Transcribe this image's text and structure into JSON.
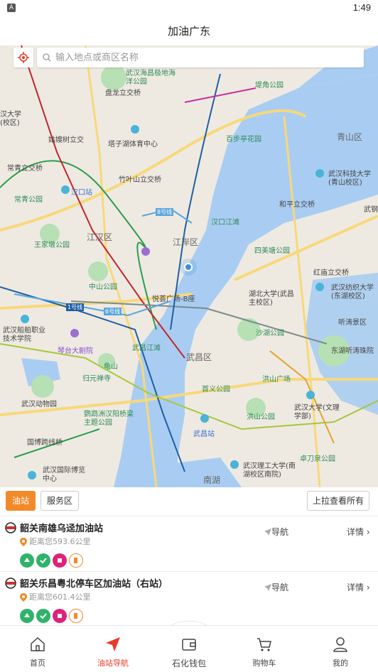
{
  "status": {
    "time": "1:49",
    "app_glyph": "A"
  },
  "title": "加油广东",
  "search": {
    "placeholder": "输入地点或商区名称"
  },
  "map": {
    "labels": [
      "武汉海昌极地海洋公园",
      "盘龙立交桥",
      "堤角公园",
      "姑嫂树立交",
      "塔子湖体育中心",
      "百步亭花园",
      "常青立交桥",
      "竹叶山立交桥",
      "汉口站",
      "常青公园",
      "8号线",
      "汉口江滩",
      "武汉科技大学(青山校区)",
      "和平立交桥",
      "武钢",
      "王家墩公园",
      "江汉区",
      "江岸区",
      "四美塘公园",
      "中山公园",
      "悦荟广场-B座",
      "湖北大学(武昌主校区)",
      "红庙立交桥",
      "武汉纺织大学(东湖校区)",
      "1号线",
      "6号线",
      "沙湖公园",
      "听涛景区",
      "武汉船舶职业技术学院",
      "琴台大剧院",
      "武昌江滩",
      "武昌区",
      "东湖听涛珠院",
      "龟山",
      "归元禅寺",
      "洪山广场",
      "首义公园",
      "武汉动物园",
      "鹦鹉洲汉阳桥梁主题公园",
      "洪山公园",
      "武汉大学(文理学部)",
      "国博跨线桥",
      "武昌站",
      "卓刀泉公园",
      "武汉国际博览中心",
      "南湖",
      "武汉理工大学(南湖校区南院)",
      "青山区",
      "汉大学(校区)"
    ]
  },
  "filters": {
    "gas": "油站",
    "service": "服务区",
    "pull_all": "上拉查看所有"
  },
  "stations": [
    {
      "name": "韶关南雄乌迳加油站",
      "distance": "距离您593.6公里",
      "nav": "导航",
      "detail": "详情"
    },
    {
      "name": "韶关乐昌粤北停车区加油站（右站）",
      "distance": "距离您601.4公里",
      "nav": "导航",
      "detail": "详情"
    }
  ],
  "tabs": [
    {
      "label": "首页",
      "icon": "home-icon"
    },
    {
      "label": "油站导航",
      "icon": "navigation-arrow-icon"
    },
    {
      "label": "石化钱包",
      "icon": "wallet-icon"
    },
    {
      "label": "购物车",
      "icon": "cart-icon"
    },
    {
      "label": "我的",
      "icon": "user-icon"
    }
  ],
  "colors": {
    "accent": "#f28a2a",
    "active_tab": "#e83a2a",
    "water": "#a9cdf2",
    "park": "#b7e0b4"
  }
}
